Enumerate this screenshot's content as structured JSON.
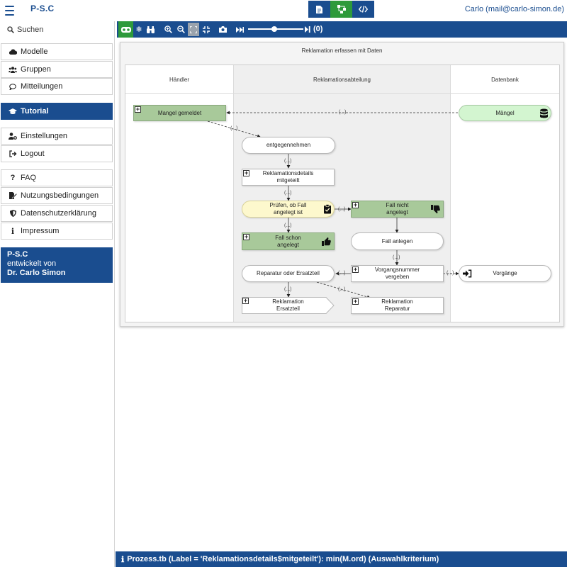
{
  "header": {
    "brand": "P-S.C",
    "user": "Carlo (mail@carlo-simon.de)",
    "views": [
      {
        "icon": "document-icon"
      },
      {
        "icon": "process-tree-icon",
        "active": true
      },
      {
        "icon": "code-icon"
      }
    ]
  },
  "sidebar": {
    "search": "Suchen",
    "items": [
      {
        "label": "Modelle",
        "icon": "cloud-icon"
      },
      {
        "label": "Gruppen",
        "icon": "users-icon"
      },
      {
        "label": "Mitteilungen",
        "icon": "comment-icon"
      },
      {
        "label": "Tutorial",
        "icon": "graduation-cap-icon",
        "active": true
      },
      {
        "label": "Einstellungen",
        "icon": "user-cog-icon"
      },
      {
        "label": "Logout",
        "icon": "sign-out-icon"
      },
      {
        "label": "FAQ",
        "icon": "question-icon"
      },
      {
        "label": "Nutzungsbedingungen",
        "icon": "file-signature-icon"
      },
      {
        "label": "Datenschutzerklärung",
        "icon": "shield-icon"
      },
      {
        "label": "Impressum",
        "icon": "info-icon"
      }
    ],
    "info": {
      "line1": "P-S.C",
      "line2": "entwickelt von",
      "line3": "Dr. Carlo Simon"
    }
  },
  "toolbar": {
    "step_count": "(0)",
    "slider_fraction": 0.47
  },
  "process": {
    "title": "Reklamation erfassen mit Daten",
    "lanes": [
      "Händler",
      "Reklamationsabteilung",
      "Datenbank"
    ],
    "nodes": {
      "mangel_gemeldet": "Mangel gemeldet",
      "maengel": "Mängel",
      "entgegennehmen": "entgegennehmen",
      "reklamationsdetails": "Reklamationsdetails mitgeteilt",
      "pruefen": "Prüfen, ob Fall angelegt ist",
      "fall_nicht_angelegt": "Fall nicht angelegt",
      "fall_schon_angelegt": "Fall schon angelegt",
      "fall_anlegen": "Fall anlegen",
      "reparatur_oder_ersatzteil": "Reparatur oder Ersatzteil",
      "vorgangsnummer": "Vorgangsnummer vergeben",
      "vorgaenge": "Vorgänge",
      "reklamation_ersatzteil": "Reklamation Ersatzteil",
      "reklamation_reparatur": "Reklamation Reparatur"
    },
    "edge_label": "(...)"
  },
  "status": {
    "text": "Prozess.tb (Label = 'Reklamationsdetails$mitgeteilt'): min(M.ord) (Auswahlkriterium)"
  }
}
